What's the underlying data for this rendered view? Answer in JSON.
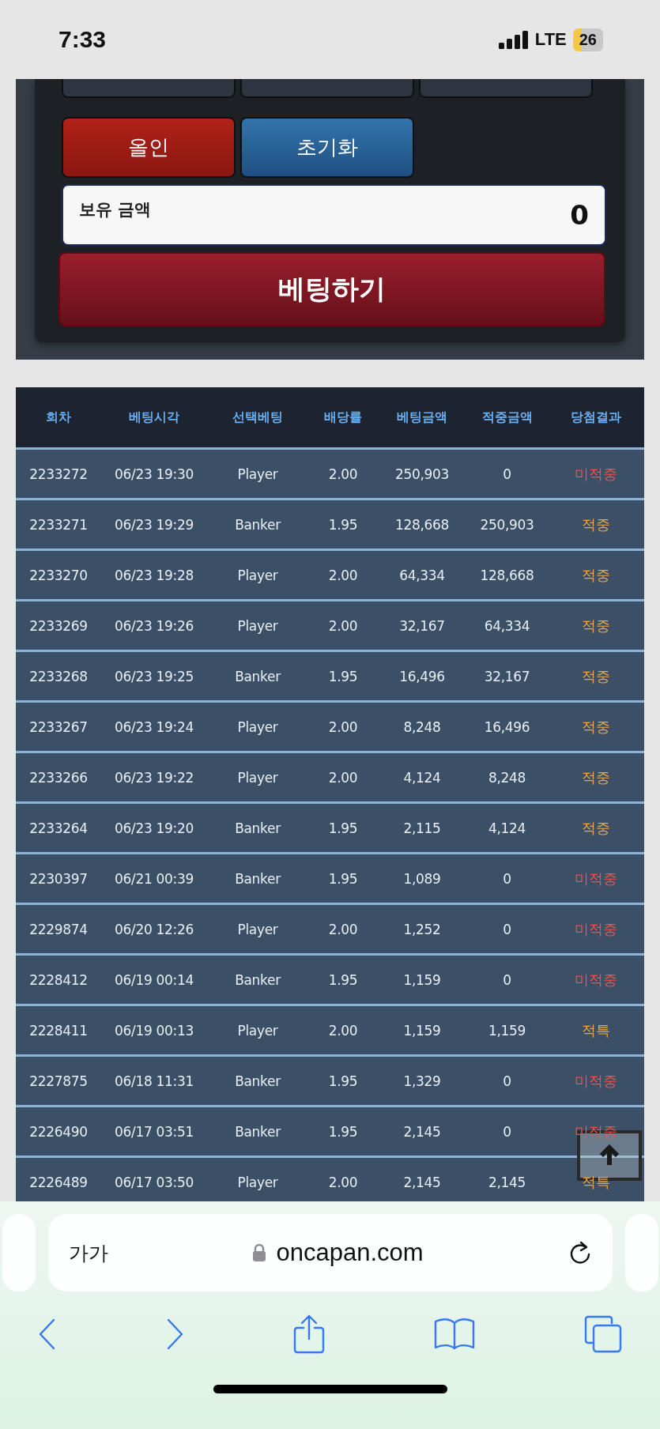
{
  "status_bar": {
    "time": "7:33",
    "network": "LTE",
    "battery": "26"
  },
  "controls": {
    "all_in": "올인",
    "reset": "초기화",
    "balance_label": "보유 금액",
    "balance_value": "0",
    "bet_button": "베팅하기"
  },
  "table": {
    "columns": [
      "회차",
      "베팅시각",
      "선택베팅",
      "배당률",
      "베팅금액",
      "적중금액",
      "당첨결과"
    ],
    "rows": [
      {
        "cells": [
          "2233272",
          "06/23 19:30",
          "Player",
          "2.00",
          "250,903",
          "0",
          "미적중"
        ],
        "hit": false
      },
      {
        "cells": [
          "2233271",
          "06/23 19:29",
          "Banker",
          "1.95",
          "128,668",
          "250,903",
          "적중"
        ],
        "hit": true
      },
      {
        "cells": [
          "2233270",
          "06/23 19:28",
          "Player",
          "2.00",
          "64,334",
          "128,668",
          "적중"
        ],
        "hit": true
      },
      {
        "cells": [
          "2233269",
          "06/23 19:26",
          "Player",
          "2.00",
          "32,167",
          "64,334",
          "적중"
        ],
        "hit": true
      },
      {
        "cells": [
          "2233268",
          "06/23 19:25",
          "Banker",
          "1.95",
          "16,496",
          "32,167",
          "적중"
        ],
        "hit": true
      },
      {
        "cells": [
          "2233267",
          "06/23 19:24",
          "Player",
          "2.00",
          "8,248",
          "16,496",
          "적중"
        ],
        "hit": true
      },
      {
        "cells": [
          "2233266",
          "06/23 19:22",
          "Player",
          "2.00",
          "4,124",
          "8,248",
          "적중"
        ],
        "hit": true
      },
      {
        "cells": [
          "2233264",
          "06/23 19:20",
          "Banker",
          "1.95",
          "2,115",
          "4,124",
          "적중"
        ],
        "hit": true
      },
      {
        "cells": [
          "2230397",
          "06/21 00:39",
          "Banker",
          "1.95",
          "1,089",
          "0",
          "미적중"
        ],
        "hit": false
      },
      {
        "cells": [
          "2229874",
          "06/20 12:26",
          "Player",
          "2.00",
          "1,252",
          "0",
          "미적중"
        ],
        "hit": false
      },
      {
        "cells": [
          "2228412",
          "06/19 00:14",
          "Banker",
          "1.95",
          "1,159",
          "0",
          "미적중"
        ],
        "hit": false
      },
      {
        "cells": [
          "2228411",
          "06/19 00:13",
          "Player",
          "2.00",
          "1,159",
          "1,159",
          "적특"
        ],
        "hit": true
      },
      {
        "cells": [
          "2227875",
          "06/18 11:31",
          "Banker",
          "1.95",
          "1,329",
          "0",
          "미적중"
        ],
        "hit": false
      },
      {
        "cells": [
          "2226490",
          "06/17 03:51",
          "Banker",
          "1.95",
          "2,145",
          "0",
          "미적중"
        ],
        "hit": false
      },
      {
        "cells": [
          "2226489",
          "06/17 03:50",
          "Player",
          "2.00",
          "2,145",
          "2,145",
          "적특"
        ],
        "hit": true
      }
    ]
  },
  "browser": {
    "text_size": "가가",
    "url": "oncapan.com"
  }
}
